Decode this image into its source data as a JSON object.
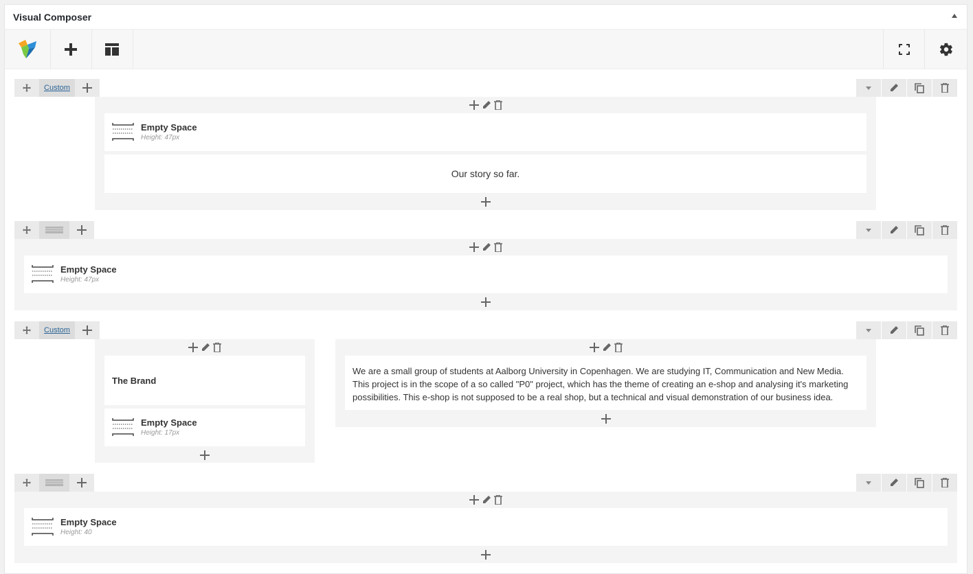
{
  "panel": {
    "title": "Visual Composer"
  },
  "rows": [
    {
      "layout_label": "Custom",
      "columns": [
        {
          "elements": [
            {
              "type": "empty_space",
              "title": "Empty Space",
              "sub": "Height: 47px"
            },
            {
              "type": "text",
              "text": "Our story so far."
            }
          ]
        }
      ]
    },
    {
      "layout_label": "",
      "columns": [
        {
          "elements": [
            {
              "type": "empty_space",
              "title": "Empty Space",
              "sub": "Height: 47px"
            }
          ]
        }
      ]
    },
    {
      "layout_label": "Custom",
      "columns": [
        {
          "elements": [
            {
              "type": "text",
              "text": "The Brand"
            },
            {
              "type": "empty_space",
              "title": "Empty Space",
              "sub": "Height: 17px"
            }
          ]
        },
        {
          "elements": [
            {
              "type": "text",
              "text": "We are a small group of students at Aalborg University in Copenhagen. We are studying IT, Communication and New Media. This project is in the scope of a so called \"P0\" project, which has the theme of creating an e-shop and analysing it's marketing possibilities. This e-shop is not supposed to be a real shop, but a technical and visual demonstration of our business idea."
            }
          ]
        }
      ]
    },
    {
      "layout_label": "",
      "columns": [
        {
          "elements": [
            {
              "type": "empty_space",
              "title": "Empty Space",
              "sub": "Height: 40"
            }
          ]
        }
      ]
    }
  ],
  "icons": {
    "logo": "visual-composer-logo",
    "add": "plus-icon",
    "templates": "layout-icon",
    "fullscreen": "fullscreen-icon",
    "settings": "gear-icon"
  },
  "colors": {
    "logo_orange": "#f5a623",
    "logo_blue": "#2f8fd8",
    "logo_green": "#7ac943",
    "link": "#2a6496"
  }
}
